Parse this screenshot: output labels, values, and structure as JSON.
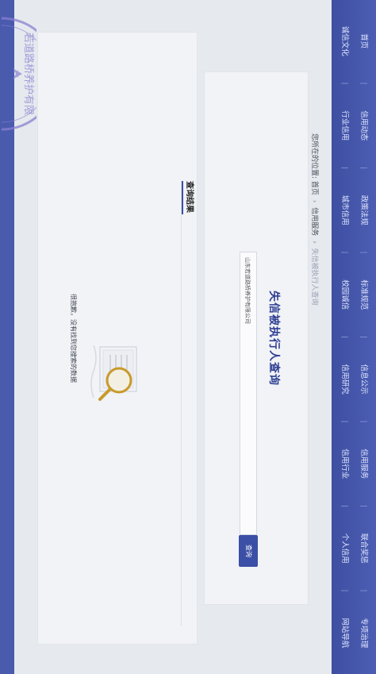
{
  "nav": {
    "row1": [
      "首页",
      "信用动态",
      "政策法规",
      "标准规范",
      "信息公示",
      "信用服务",
      "联合奖惩",
      "专项治理"
    ],
    "row2": [
      "诚信文化",
      "行业信用",
      "城市信用",
      "校园诚信",
      "信用研究",
      "信用行业",
      "个人信用",
      "网站导航"
    ]
  },
  "breadcrumb": {
    "prefix": "您所在的位置:",
    "home": "首页",
    "section": "信用服务",
    "current": "失信被执行人查询",
    "arrow": "›"
  },
  "query": {
    "title": "失信被执行人查询",
    "input_value": "山东若道路桥养护有限公司",
    "button_label": "查询"
  },
  "results": {
    "title": "查询结果",
    "empty_message": "很抱歉，没有找到您搜索的数据"
  },
  "stamp": {
    "text": "若道路桥养护有限"
  },
  "colors": {
    "nav_bg": "#4c5eb3",
    "accent": "#3b4fa6",
    "title": "#2f3f93",
    "magnifier": "#c79a2a",
    "stamp": "#8a7fd0"
  }
}
